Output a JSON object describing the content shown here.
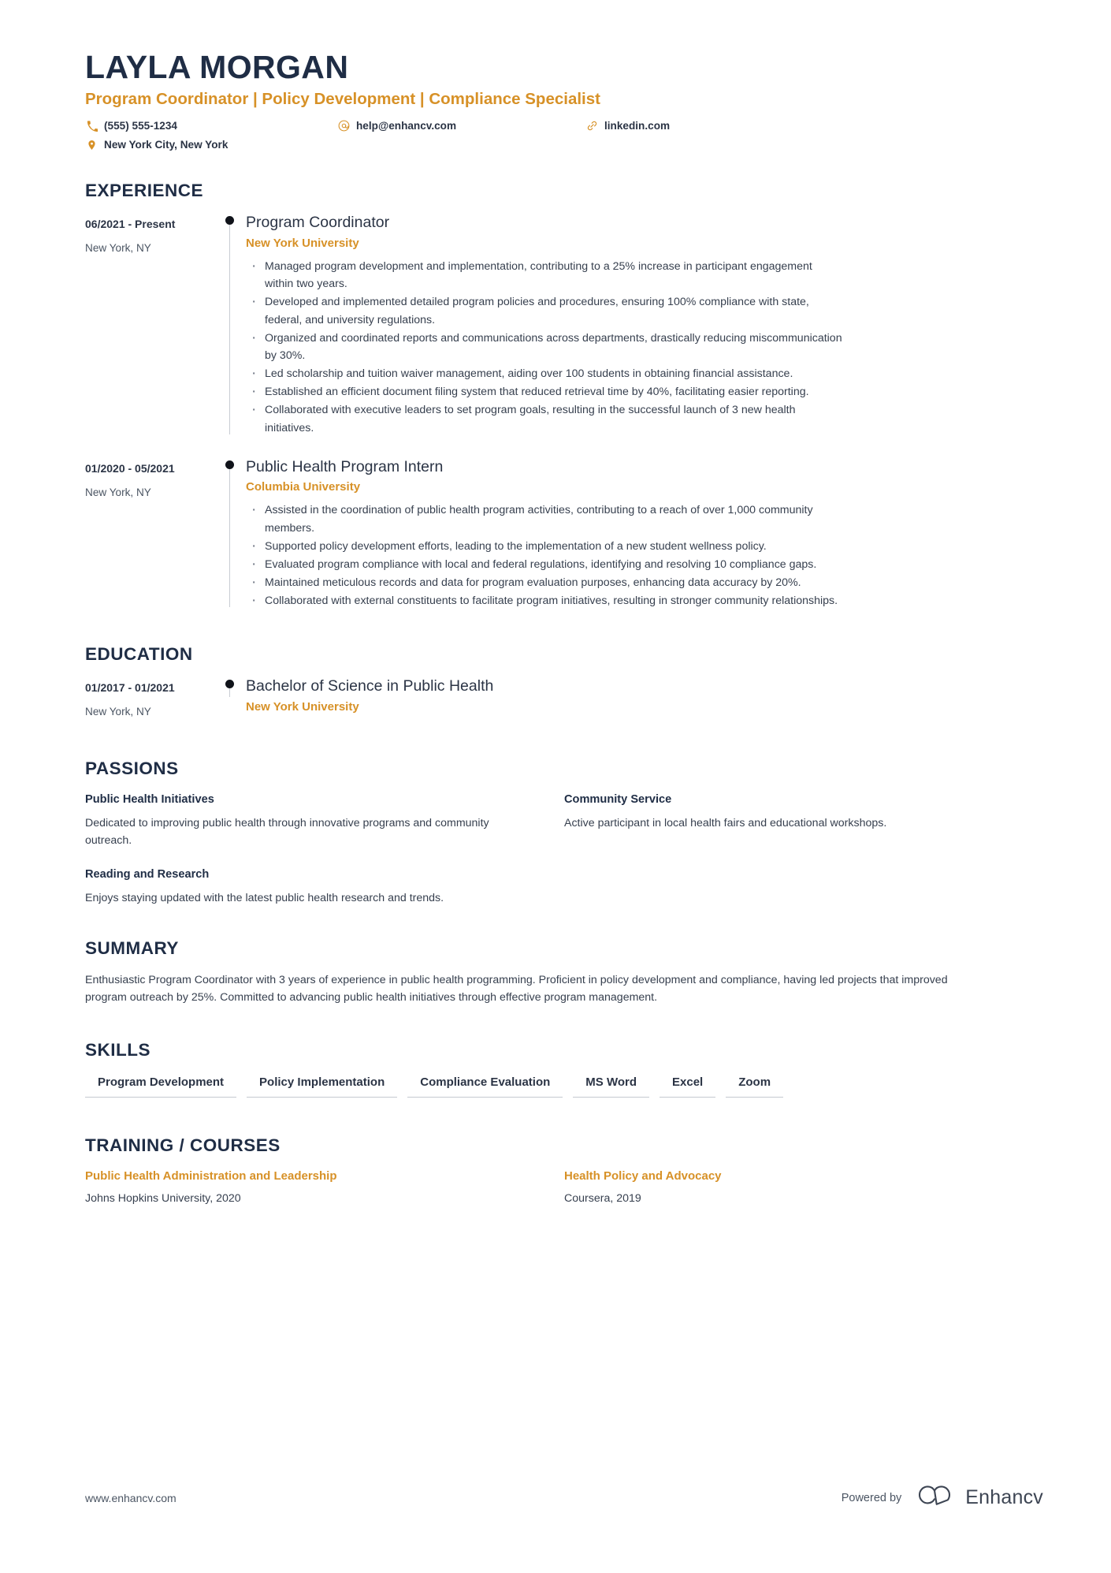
{
  "header": {
    "name": "LAYLA MORGAN",
    "headline": "Program Coordinator | Policy Development | Compliance Specialist",
    "contacts": [
      {
        "icon": "phone-icon",
        "text": "(555) 555-1234"
      },
      {
        "icon": "email-icon",
        "text": "help@enhancv.com"
      },
      {
        "icon": "link-icon",
        "text": "linkedin.com"
      },
      {
        "icon": "location-icon",
        "text": "New York City, New York"
      }
    ]
  },
  "colors": {
    "accent": "#d79127",
    "heading": "#1f2d45",
    "body": "#37404f",
    "rail": "#c8ccd3"
  },
  "experience": {
    "title": "EXPERIENCE",
    "entries": [
      {
        "date": "06/2021 - Present",
        "location": "New York, NY",
        "role": "Program Coordinator",
        "organization": "New York University",
        "bullets": [
          "Managed program development and implementation, contributing to a 25% increase in participant engagement within two years.",
          "Developed and implemented detailed program policies and procedures, ensuring 100% compliance with state, federal, and university regulations.",
          "Organized and coordinated reports and communications across departments, drastically reducing miscommunication by 30%.",
          "Led scholarship and tuition waiver management, aiding over 100 students in obtaining financial assistance.",
          "Established an efficient document filing system that reduced retrieval time by 40%, facilitating easier reporting.",
          "Collaborated with executive leaders to set program goals, resulting in the successful launch of 3 new health initiatives."
        ]
      },
      {
        "date": "01/2020 - 05/2021",
        "location": "New York, NY",
        "role": "Public Health Program Intern",
        "organization": "Columbia University",
        "bullets": [
          "Assisted in the coordination of public health program activities, contributing to a reach of over 1,000 community members.",
          "Supported policy development efforts, leading to the implementation of a new student wellness policy.",
          "Evaluated program compliance with local and federal regulations, identifying and resolving 10 compliance gaps.",
          "Maintained meticulous records and data for program evaluation purposes, enhancing data accuracy by 20%.",
          "Collaborated with external constituents to facilitate program initiatives, resulting in stronger community relationships."
        ]
      }
    ]
  },
  "education": {
    "title": "EDUCATION",
    "entries": [
      {
        "date": "01/2017 - 01/2021",
        "location": "New York, NY",
        "degree": "Bachelor of Science in Public Health",
        "school": "New York University"
      }
    ]
  },
  "passions": {
    "title": "PASSIONS",
    "items": [
      {
        "name": "Public Health Initiatives",
        "description": "Dedicated to improving public health through innovative programs and community outreach."
      },
      {
        "name": "Community Service",
        "description": "Active participant in local health fairs and educational workshops."
      },
      {
        "name": "Reading and Research",
        "description": "Enjoys staying updated with the latest public health research and trends."
      }
    ]
  },
  "summary": {
    "title": "SUMMARY",
    "text": "Enthusiastic Program Coordinator with 3 years of experience in public health programming. Proficient in policy development and compliance, having led projects that improved program outreach by 25%. Committed to advancing public health initiatives through effective program management."
  },
  "skills": {
    "title": "SKILLS",
    "items": [
      "Program Development",
      "Policy Implementation",
      "Compliance Evaluation",
      "MS Word",
      "Excel",
      "Zoom"
    ]
  },
  "training": {
    "title": "TRAINING / COURSES",
    "items": [
      {
        "name": "Public Health Administration and Leadership",
        "provider": "Johns Hopkins University, 2020"
      },
      {
        "name": "Health Policy and Advocacy",
        "provider": "Coursera, 2019"
      }
    ]
  },
  "footer": {
    "url": "www.enhancv.com",
    "powered_by": "Powered by",
    "brand": "Enhancv"
  }
}
